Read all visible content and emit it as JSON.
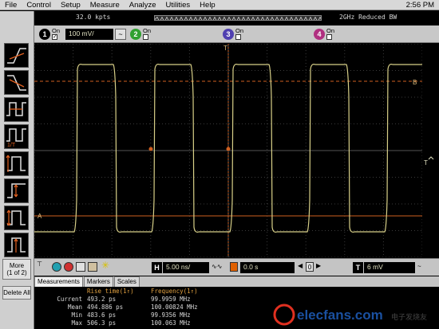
{
  "menu": {
    "items": [
      "File",
      "Control",
      "Setup",
      "Measure",
      "Analyze",
      "Utilities",
      "Help"
    ],
    "clock": "2:56 PM"
  },
  "info": {
    "sample_points": "32.0 kpts",
    "bandwidth": "2GHz Reduced BW"
  },
  "channels": [
    {
      "num": "1",
      "on_label": "On",
      "scale": "100 mV/",
      "color": "#d8d040"
    },
    {
      "num": "2",
      "on_label": "On",
      "color": "#30a030"
    },
    {
      "num": "3",
      "on_label": "On",
      "color": "#5040b0"
    },
    {
      "num": "4",
      "on_label": "On",
      "color": "#b03080"
    }
  ],
  "display": {
    "trace_color": "#d8d088",
    "grid_color": "#3a3a3a",
    "marker_a_label": "A",
    "marker_b_label": "B",
    "trigger_label": "T"
  },
  "controls": {
    "h_label": "H",
    "timebase": "5.00 ns/",
    "delay": "0.0 s",
    "trigger_level_label": "T",
    "trigger_level": "6 mV"
  },
  "sidebar": {
    "more_label": "More",
    "more_page": "(1 of 2)",
    "delete_all_label": "Delete All"
  },
  "tabs": [
    "Measurements",
    "Markers",
    "Scales"
  ],
  "measurements": {
    "col1_header": "Rise time(1↑)",
    "col2_header": "Frequency(1↑)",
    "rows": [
      {
        "label": "Current",
        "v1": "493.2 ps",
        "v2": "99.9959 MHz"
      },
      {
        "label": "Mean",
        "v1": "494.886 ps",
        "v2": "100.00824 MHz"
      },
      {
        "label": "Min",
        "v1": "483.6 ps",
        "v2": "99.9356 MHz"
      },
      {
        "label": "Max",
        "v1": "506.3 ps",
        "v2": "100.063 MHz"
      }
    ]
  },
  "watermark": {
    "text": "elecfans.com",
    "subtext": "电子发烧友"
  }
}
